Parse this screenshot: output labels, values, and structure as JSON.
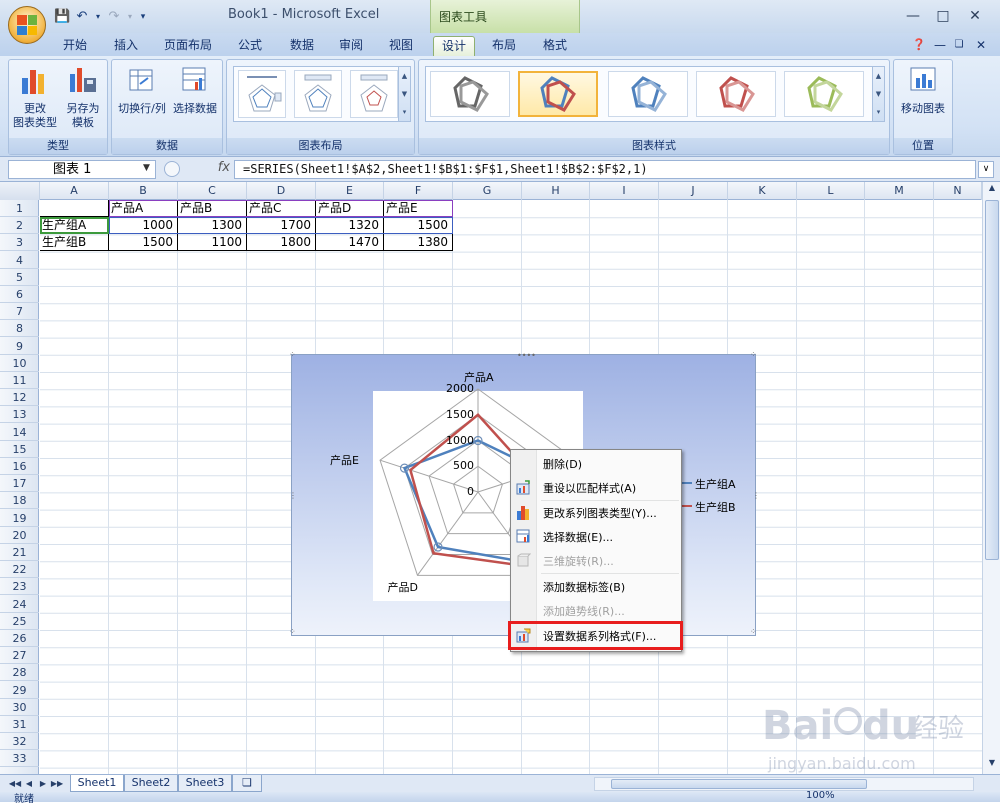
{
  "window": {
    "title": "Book1 - Microsoft Excel",
    "context_tab_title": "图表工具"
  },
  "tabs": [
    "开始",
    "插入",
    "页面布局",
    "公式",
    "数据",
    "审阅",
    "视图",
    "设计",
    "布局",
    "格式"
  ],
  "active_tab": "设计",
  "ribbon": {
    "group_type": {
      "label": "类型",
      "btn_change_type": [
        "更改",
        "图表类型"
      ],
      "btn_save_template": [
        "另存为",
        "模板"
      ]
    },
    "group_data": {
      "label": "数据",
      "btn_switch": "切换行/列",
      "btn_select": "选择数据"
    },
    "group_layout": {
      "label": "图表布局"
    },
    "group_styles": {
      "label": "图表样式"
    },
    "group_location": {
      "label": "位置",
      "btn_move": "移动图表"
    }
  },
  "formula_bar": {
    "name_box": "图表 1",
    "fx": "fx",
    "formula": "=SERIES(Sheet1!$A$2,Sheet1!$B$1:$F$1,Sheet1!$B$2:$F$2,1)"
  },
  "columns": [
    "A",
    "B",
    "C",
    "D",
    "E",
    "F",
    "G",
    "H",
    "I",
    "J",
    "K",
    "L",
    "M",
    "N"
  ],
  "rows": [
    "1",
    "2",
    "3",
    "4",
    "5",
    "6",
    "7",
    "8",
    "9",
    "10",
    "11",
    "12",
    "13",
    "14",
    "15",
    "16",
    "17",
    "18",
    "19",
    "20",
    "21",
    "22",
    "23",
    "24",
    "25",
    "26",
    "27",
    "28",
    "29",
    "30",
    "31",
    "32",
    "33"
  ],
  "sheet": {
    "header": [
      "产品A",
      "产品B",
      "产品C",
      "产品D",
      "产品E"
    ],
    "row2": {
      "label": "生产组A",
      "values": [
        "1000",
        "1300",
        "1700",
        "1320",
        "1500"
      ]
    },
    "row3": {
      "label": "生产组B",
      "values": [
        "1500",
        "1100",
        "1800",
        "1470",
        "1380"
      ]
    }
  },
  "sheet_tabs": [
    "Sheet1",
    "Sheet2",
    "Sheet3"
  ],
  "status": {
    "ready": "就绪",
    "zoom": "100%"
  },
  "chart_data": {
    "type": "radar",
    "categories": [
      "产品A",
      "产品B",
      "产品C",
      "产品D",
      "产品E"
    ],
    "series": [
      {
        "name": "生产组A",
        "values": [
          1000,
          1300,
          1700,
          1320,
          1500
        ],
        "color": "#4f81bd"
      },
      {
        "name": "生产组B",
        "values": [
          1500,
          1100,
          1800,
          1470,
          1380
        ],
        "color": "#c0504d"
      }
    ],
    "radial_ticks": [
      "2000",
      "1500",
      "1000",
      "500",
      "0"
    ],
    "rmax": 2000,
    "legend_position": "right"
  },
  "context_menu": {
    "items": [
      {
        "label": "删除(D)",
        "icon": "none",
        "enabled": true
      },
      {
        "label": "重设以匹配样式(A)",
        "icon": "reset-style-icon",
        "enabled": true
      },
      {
        "label": "更改系列图表类型(Y)...",
        "icon": "bar-chart-icon",
        "enabled": true
      },
      {
        "label": "选择数据(E)...",
        "icon": "select-data-icon",
        "enabled": true
      },
      {
        "label": "三维旋转(R)...",
        "icon": "3d-rotate-icon",
        "enabled": false
      },
      {
        "label": "添加数据标签(B)",
        "icon": "none",
        "enabled": true
      },
      {
        "label": "添加趋势线(R)...",
        "icon": "none",
        "enabled": false
      },
      {
        "label": "设置数据系列格式(F)...",
        "icon": "format-series-icon",
        "enabled": true
      }
    ]
  },
  "watermark": {
    "brand": "Bai",
    "brand2": "du",
    "site_cn": "经验",
    "url": "jingyan.baidu.com"
  },
  "colors": {
    "highlight": "#e81d1d",
    "series_a": "#4f81bd",
    "series_b": "#c0504d"
  }
}
